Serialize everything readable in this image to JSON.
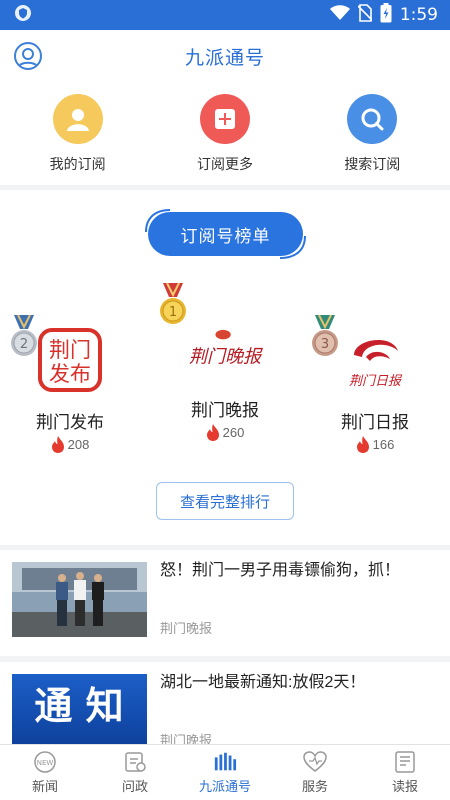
{
  "status_bar": {
    "time": "1:59"
  },
  "header": {
    "title": "九派通号"
  },
  "quick_actions": [
    {
      "label": "我的订阅",
      "color": "#f5c95b",
      "icon": "user-icon"
    },
    {
      "label": "订阅更多",
      "color": "#ef5a57",
      "icon": "plus-icon"
    },
    {
      "label": "搜索订阅",
      "color": "#4a8fe6",
      "icon": "search-icon"
    }
  ],
  "ranking": {
    "title": "订阅号榜单",
    "items": [
      {
        "rank": "2",
        "name": "荆门发布",
        "heat": "208",
        "logo_text": "荆门发布",
        "logo_color": "#d8322b"
      },
      {
        "rank": "1",
        "name": "荆门晚报",
        "heat": "260",
        "logo_text": "荆门晚报",
        "logo_color": "#b61c25"
      },
      {
        "rank": "3",
        "name": "荆门日报",
        "heat": "166",
        "logo_text": "荆门日报",
        "logo_color": "#c8202a"
      }
    ],
    "full_button": "查看完整排行"
  },
  "news": [
    {
      "title": "怒！荆门一男子用毒镖偷狗，抓！",
      "source": "荆门晚报"
    },
    {
      "title": "湖北一地最新通知:放假2天！",
      "source": "荆门晚报",
      "thumb_text": "通 知"
    }
  ],
  "tabs": [
    {
      "label": "新闻",
      "icon": "news-icon",
      "badge": "NEW",
      "active": false
    },
    {
      "label": "问政",
      "icon": "inquiry-icon",
      "active": false
    },
    {
      "label": "九派通号",
      "icon": "jiupai-icon",
      "active": true
    },
    {
      "label": "服务",
      "icon": "service-icon",
      "active": false
    },
    {
      "label": "读报",
      "icon": "newspaper-icon",
      "active": false
    }
  ],
  "colors": {
    "primary": "#2a6fd6",
    "flame": "#e53a2f"
  }
}
